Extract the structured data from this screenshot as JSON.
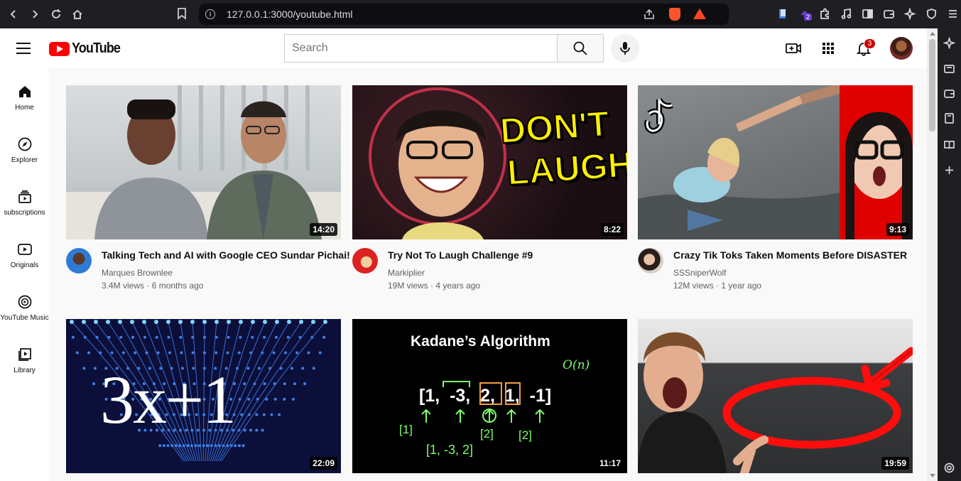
{
  "browser": {
    "url": "127.0.0.1:3000/youtube.html",
    "extension_badge": "2"
  },
  "header": {
    "logo_text": "YouTube",
    "search_placeholder": "Search",
    "notifications_count": "3"
  },
  "nav": [
    {
      "label": "Home",
      "icon": "home-icon"
    },
    {
      "label": "Explorer",
      "icon": "compass-icon"
    },
    {
      "label": "subscriptions",
      "icon": "subscriptions-icon"
    },
    {
      "label": "Originals",
      "icon": "originals-icon"
    },
    {
      "label": "YouTube Music",
      "icon": "music-icon"
    },
    {
      "label": "Library",
      "icon": "library-icon"
    }
  ],
  "videos": [
    {
      "title": "Talking Tech and AI with Google CEO Sundar Pichai!",
      "channel": "Marques Brownlee",
      "views": "3.4M views",
      "age": "6 months ago",
      "duration": "14:20"
    },
    {
      "title": "Try Not To Laugh Challenge #9",
      "channel": "Markiplier",
      "views": "19M views",
      "age": "4 years ago",
      "duration": "8:22",
      "thumb_text": [
        "DON'T",
        "LAUGH"
      ]
    },
    {
      "title": "Crazy Tik Toks Taken Moments Before DISASTER",
      "channel": "SSSniperWolf",
      "views": "12M views",
      "age": "1 year ago",
      "duration": "9:13"
    },
    {
      "title": "",
      "channel": "",
      "views": "",
      "age": "",
      "duration": "22:09",
      "thumb_text": [
        "3x+1"
      ]
    },
    {
      "title": "",
      "channel": "",
      "views": "",
      "age": "",
      "duration": "11:17",
      "thumb_text": [
        "Kadane’s Algorithm",
        "[1,  -3,  2,  1,  -1]",
        "O(n)",
        "[1]",
        "[2]",
        "[2]",
        "[1, -3, 2]"
      ]
    },
    {
      "title": "",
      "channel": "",
      "views": "",
      "age": "",
      "duration": "19:59"
    }
  ],
  "colors": {
    "brand_red": "#ff0000",
    "badge_red": "#cc0000"
  }
}
